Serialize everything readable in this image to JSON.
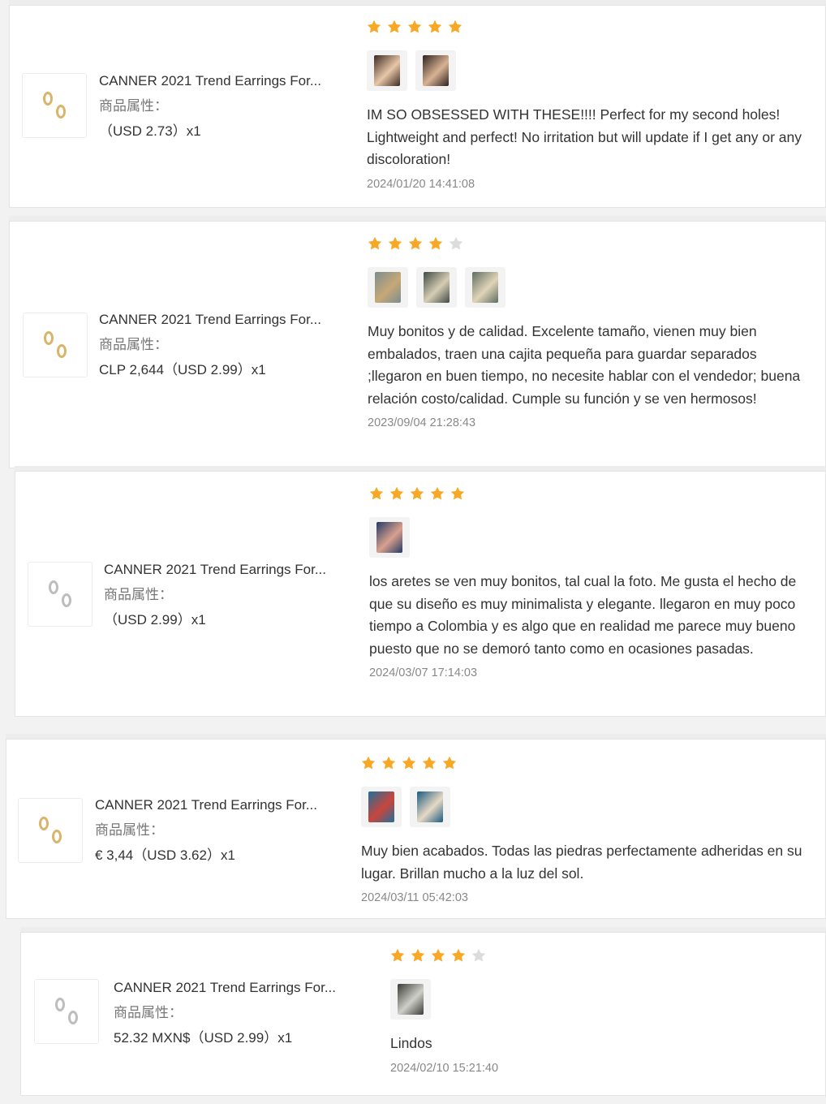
{
  "reviews": [
    {
      "product_title": "CANNER 2021 Trend Earrings For...",
      "attr_label": "商品属性：",
      "price": "（USD  2.73）x1",
      "ring_color": "gold",
      "rating": 5,
      "photos": [
        {
          "name": "review-photo-ear",
          "colors": [
            "#3b2a22",
            "#e8c6a8"
          ]
        },
        {
          "name": "review-photo-ear",
          "colors": [
            "#2c2320",
            "#d9b293"
          ]
        }
      ],
      "text": "IM SO OBSESSED WITH THESE!!!! Perfect for my second holes! Lightweight and perfect! No irritation but will update if I get any or any discoloration!",
      "date": "2024/01/20 14:41:08"
    },
    {
      "product_title": "CANNER 2021 Trend Earrings For...",
      "attr_label": "商品属性：",
      "price": "CLP 2,644（USD  2.99）x1",
      "ring_color": "gold",
      "rating": 4,
      "photos": [
        {
          "name": "review-photo-package",
          "colors": [
            "#7a8d8e",
            "#c7a877"
          ]
        },
        {
          "name": "review-photo-package",
          "colors": [
            "#3f4a44",
            "#d6cdb5"
          ]
        },
        {
          "name": "review-photo-package",
          "colors": [
            "#5e6d62",
            "#e1d4b8"
          ]
        }
      ],
      "text": "Muy bonitos y de calidad. Excelente tamaño, vienen muy bien embalados, traen una cajita pequeña para guardar separados ;llegaron en buen tiempo, no necesite hablar con el vendedor; buena relación costo/calidad. Cumple su función y se ven hermosos!",
      "date": "2023/09/04 21:28:43"
    },
    {
      "product_title": "CANNER 2021 Trend Earrings For...",
      "attr_label": "商品属性：",
      "price": "（USD  2.99）x1",
      "ring_color": "silver",
      "rating": 5,
      "photos": [
        {
          "name": "review-photo-hand",
          "colors": [
            "#233a66",
            "#d9a08e"
          ]
        }
      ],
      "text": "los aretes se ven muy bonitos, tal cual la foto. Me gusta el hecho de que su diseño es muy minimalista y elegante. llegaron en muy poco tiempo a Colombia y es algo que en realidad me parece muy bueno puesto que no se demoró tanto como en ocasiones pasadas.",
      "date": "2024/03/07 17:14:03"
    },
    {
      "product_title": "CANNER 2021 Trend Earrings For...",
      "attr_label": "商品属性：",
      "price": "€ 3,44（USD  3.62）x1",
      "ring_color": "gold",
      "rating": 5,
      "photos": [
        {
          "name": "review-photo-earrings",
          "colors": [
            "#1f6f9a",
            "#c9453c"
          ]
        },
        {
          "name": "review-photo-earrings",
          "colors": [
            "#1a5a80",
            "#e7d9c4"
          ]
        }
      ],
      "text": "Muy bien acabados. Todas las piedras perfectamente adheridas en su lugar. Brillan mucho a la luz del sol.",
      "date": "2024/03/11 05:42:03"
    },
    {
      "product_title": "CANNER 2021 Trend Earrings For...",
      "attr_label": "商品属性：",
      "price": "52.32 MXN$（USD  2.99）x1",
      "ring_color": "silver",
      "rating": 4,
      "photos": [
        {
          "name": "review-photo-earrings",
          "colors": [
            "#3a3a36",
            "#cfcfc9"
          ]
        }
      ],
      "text": "Lindos",
      "date": "2024/02/10 15:21:40"
    }
  ],
  "colors": {
    "star_filled": "#f8a825",
    "star_empty": "#dcdcdc",
    "ring_gold": "#d8b56a",
    "ring_silver": "#bdbdbd"
  }
}
